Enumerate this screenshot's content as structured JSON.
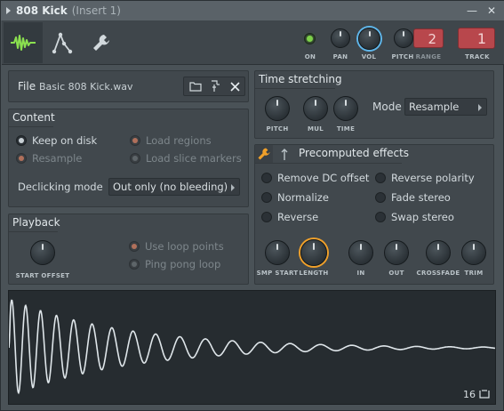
{
  "window": {
    "title": "808 Kick",
    "insert": "(Insert 1)"
  },
  "toolbar": {
    "knobs": {
      "on": "ON",
      "pan": "PAN",
      "vol": "VOL",
      "pitch": "PITCH",
      "range": "RANGE",
      "track": "TRACK"
    },
    "range_value": "2",
    "track_value": "1",
    "colors": {
      "on_led": "#7dd14a",
      "vol_ring": "#5fb6ea",
      "range_box": "#b8474c",
      "track_box": "#b8474c"
    }
  },
  "file": {
    "label": "File",
    "name": "Basic 808 Kick.wav"
  },
  "content": {
    "title": "Content",
    "keep_on_disk": "Keep on disk",
    "resample": "Resample",
    "load_regions": "Load regions",
    "load_slice_markers": "Load slice markers",
    "declicking_label": "Declicking mode",
    "declicking_value": "Out only (no bleeding)"
  },
  "playback": {
    "title": "Playback",
    "start_offset": "START OFFSET",
    "use_loop_points": "Use loop points",
    "ping_pong_loop": "Ping pong loop"
  },
  "time_stretching": {
    "title": "Time stretching",
    "pitch": "PITCH",
    "mul": "MUL",
    "time": "TIME",
    "mode_label": "Mode",
    "mode_value": "Resample"
  },
  "precomputed": {
    "title": "Precomputed effects",
    "remove_dc": "Remove DC offset",
    "normalize": "Normalize",
    "reverse": "Reverse",
    "reverse_polarity": "Reverse polarity",
    "fade_stereo": "Fade stereo",
    "swap_stereo": "Swap stereo",
    "knobs": {
      "smp_start": "SMP START",
      "length": "LENGTH",
      "in": "IN",
      "out": "OUT",
      "crossfade": "CROSSFADE",
      "trim": "TRIM"
    },
    "accent": "#f0a02a"
  },
  "waveform": {
    "bits": "16"
  }
}
